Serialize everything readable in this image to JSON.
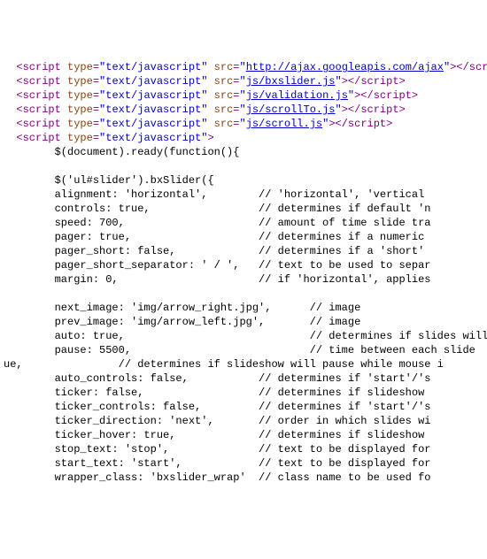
{
  "scripts": [
    {
      "type": "text/javascript",
      "src": "http://ajax.googleapis.com/ajax",
      "link": true
    },
    {
      "type": "text/javascript",
      "src": "js/bxslider.js",
      "link": true
    },
    {
      "type": "text/javascript",
      "src": "js/validation.js",
      "link": true
    },
    {
      "type": "text/javascript",
      "src": "js/scrollTo.js",
      "link": true
    },
    {
      "type": "text/javascript",
      "src": "js/scroll.js",
      "link": true
    },
    {
      "type": "text/javascript"
    }
  ],
  "js": {
    "ready": "        $(document).ready(function(){",
    "bx": "        $('ul#slider').bxSlider({",
    "opts": [
      {
        "k": "alignment: 'horizontal',",
        "c": "// 'horizontal', 'vertical"
      },
      {
        "k": "controls: true,",
        "c": "// determines if default 'n"
      },
      {
        "k": "speed: 700,",
        "c": "// amount of time slide tra"
      },
      {
        "k": "pager: true,",
        "c": "// determines if a numeric "
      },
      {
        "k": "pager_short: false,",
        "c": "// determines if a 'short' "
      },
      {
        "k": "pager_short_separator: ' / ',",
        "c": "// text to be used to separ"
      },
      {
        "k": "margin: 0,",
        "c": "// if 'horizontal', applies"
      }
    ],
    "opts2": [
      {
        "k": "next_image: 'img/arrow_right.jpg',",
        "c": "// image "
      },
      {
        "k": "prev_image: 'img/arrow_left.jpg',",
        "c": "// image "
      },
      {
        "k": "auto: true,",
        "c": "// determines if slides will "
      },
      {
        "k": "pause: 5500,",
        "c": "// time between each slide "
      }
    ],
    "wrapline": {
      "pre": "ue,               // determines if slideshow will pause while mouse i"
    },
    "opts3": [
      {
        "k": "auto_controls: false,",
        "c": "// determines if 'start'/'s"
      },
      {
        "k": "ticker: false,",
        "c": "// determines if slideshow "
      },
      {
        "k": "ticker_controls: false,",
        "c": "// determines if 'start'/'s"
      },
      {
        "k": "ticker_direction: 'next',",
        "c": "// order in which slides wi"
      },
      {
        "k": "ticker_hover: true,",
        "c": "// determines if slideshow "
      },
      {
        "k": "stop_text: 'stop',",
        "c": "// text to be displayed for"
      },
      {
        "k": "start_text: 'start',",
        "c": "// text to be displayed for"
      },
      {
        "k": "wrapper_class: 'bxslider_wrap'",
        "c": "// class name to be used fo"
      }
    ]
  },
  "layout": {
    "indent": "        ",
    "optcol": 40,
    "opt2col": 48
  }
}
